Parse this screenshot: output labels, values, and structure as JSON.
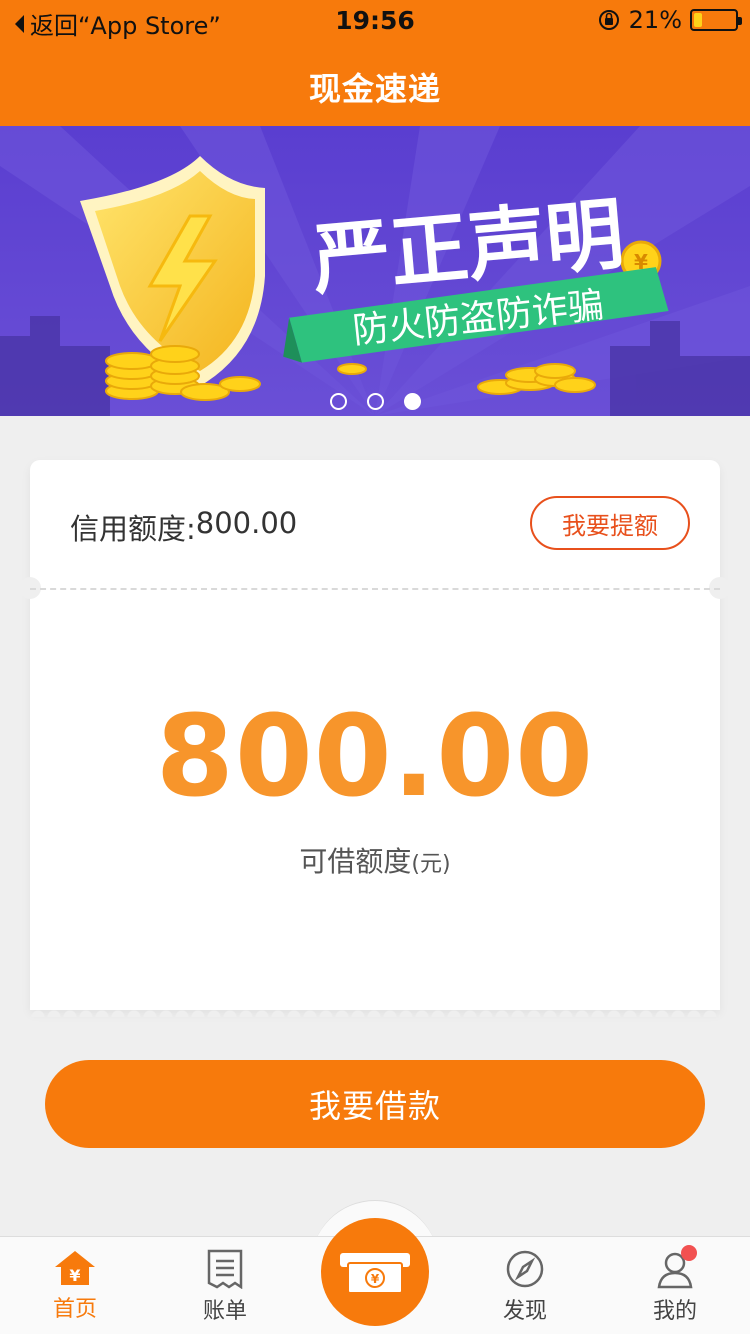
{
  "status_bar": {
    "back_label": "返回“App Store”",
    "time": "19:56",
    "battery_percent": "21%",
    "battery_level": 0.21
  },
  "nav": {
    "title": "现金速递"
  },
  "banner": {
    "headline": "严正声明",
    "ribbon_text": "防火防盗防诈骗",
    "slides": 3,
    "active_slide": 3
  },
  "card": {
    "credit_label": "信用额度:",
    "credit_value": "800.00",
    "raise_button": "我要提额",
    "available_amount": "800.00",
    "available_label": "可借额度",
    "available_unit": "(元)"
  },
  "borrow_button": "我要借款",
  "tabs": [
    {
      "label": "首页",
      "icon": "home-yen-icon",
      "active": true
    },
    {
      "label": "账单",
      "icon": "bill-icon",
      "active": false
    },
    {
      "label": "",
      "icon": "cash-icon",
      "active": false
    },
    {
      "label": "发现",
      "icon": "compass-icon",
      "active": false
    },
    {
      "label": "我的",
      "icon": "user-icon",
      "active": false
    }
  ],
  "colors": {
    "brand_orange": "#f77a0c",
    "amount_orange": "#f7952b",
    "raise_red": "#e8501c",
    "banner_purple": "#5b3fc4",
    "ribbon_green": "#2ec27e"
  }
}
